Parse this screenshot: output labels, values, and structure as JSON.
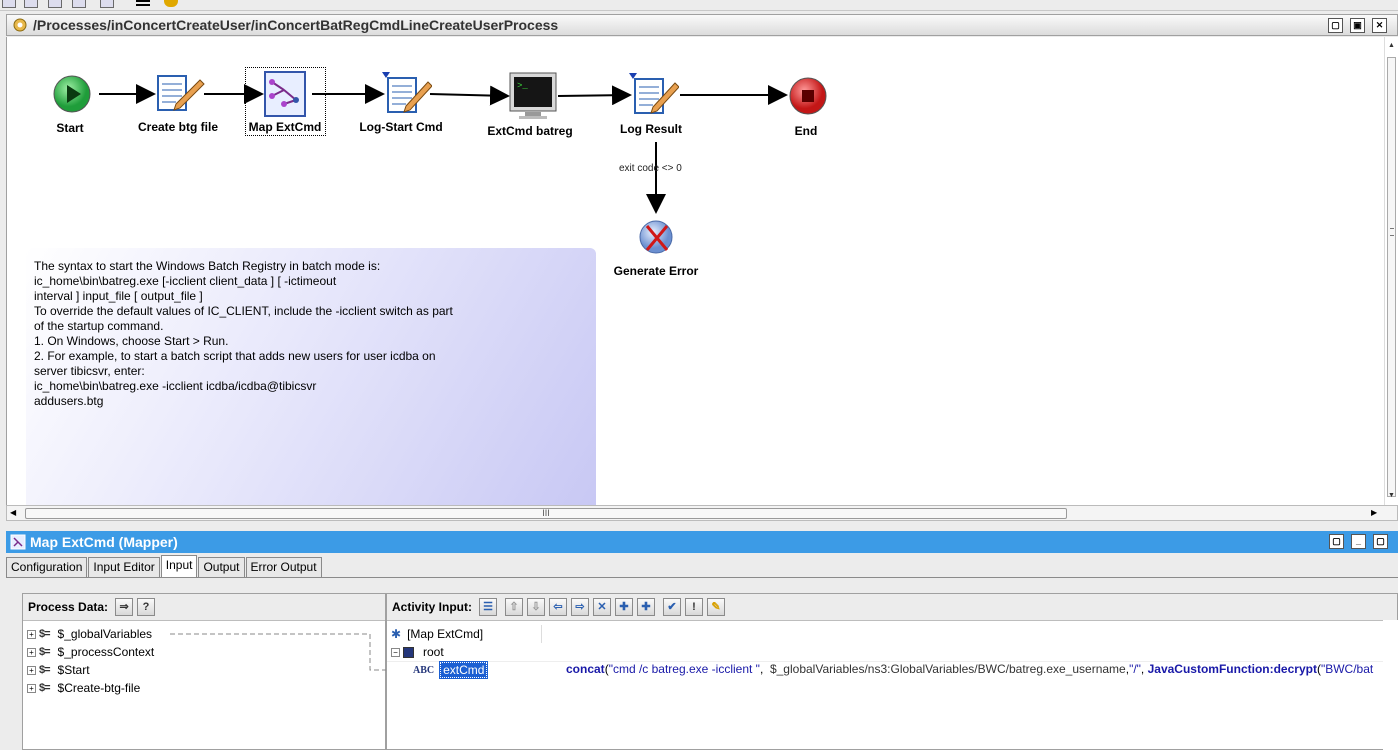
{
  "process": {
    "path": "/Processes/inConcertCreateUser/inConcertBatRegCmdLineCreateUserProcess",
    "nodes": [
      {
        "id": "start",
        "label": "Start"
      },
      {
        "id": "create-btg-file",
        "label": "Create btg file"
      },
      {
        "id": "map-extcmd",
        "label": "Map ExtCmd"
      },
      {
        "id": "log-start-cmd",
        "label": "Log-Start Cmd"
      },
      {
        "id": "extcmd-batreg",
        "label": "ExtCmd batreg"
      },
      {
        "id": "log-result",
        "label": "Log Result"
      },
      {
        "id": "end",
        "label": "End"
      },
      {
        "id": "generate-error",
        "label": "Generate Error"
      }
    ],
    "condition_label": "exit code <> 0",
    "note_text": "The syntax to start the Windows Batch Registry in batch mode is:\nic_home\\bin\\batreg.exe [-icclient client_data ] [ -ictimeout\ninterval ] input_file [ output_file ]\nTo override the default values of IC_CLIENT, include the -icclient switch as part\nof the startup command.\n1. On Windows, choose Start > Run.\n2. For example, to start a batch script that adds new users for user icdba on\nserver tibicsvr, enter:\nic_home\\bin\\batreg.exe -icclient icdba/icdba@tibicsvr\naddusers.btg",
    "hscroll_grip": "III"
  },
  "mapper": {
    "title": "Map ExtCmd (Mapper)",
    "tabs": [
      "Configuration",
      "Input Editor",
      "Input",
      "Output",
      "Error Output"
    ],
    "active_tab": "Input",
    "process_data_label": "Process Data:",
    "activity_input_label": "Activity Input:",
    "process_data_items": [
      "$_globalVariables",
      "$_processContext",
      "$Start",
      "$Create-btg-file"
    ],
    "activity_tree": {
      "root_node": "[Map ExtCmd]",
      "child": "root",
      "field": "extCmd"
    },
    "xpath": {
      "fn1": "concat",
      "open1": "(",
      "str1": "\"cmd /c batreg.exe -icclient \"",
      "sep1": ",  ",
      "var1": "$_globalVariables/ns3:GlobalVariables/BWC/batreg.exe_username",
      "sep2": ",",
      "str2": "\"/\"",
      "sep3": ", ",
      "fn2": "JavaCustomFunction:decrypt",
      "open2": "(",
      "str3": "\"BWC/bat"
    }
  },
  "icons": {
    "process": "gear-folder-icon",
    "start": "play-circle-icon",
    "end": "stop-circle-icon",
    "error": "error-x-icon",
    "mapper": "mapper-icon",
    "terminal": "monitor-icon",
    "log": "pencil-document-icon"
  },
  "colors": {
    "mapper_titlebar": "#3c9be6",
    "start_green": "#2fb84a",
    "end_red": "#d62525",
    "selection": "#1c5fd2",
    "note_gradient_end": "#c8c8f4"
  }
}
